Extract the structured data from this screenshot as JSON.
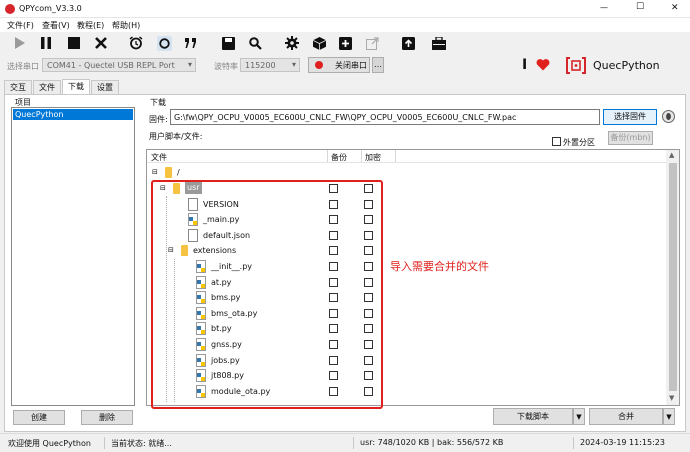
{
  "window": {
    "title": "QPYcom_V3.3.0",
    "minimize_glyph": "—",
    "maximize_glyph": "☐",
    "close_glyph": "✕"
  },
  "menu": [
    {
      "label": "文件(F)"
    },
    {
      "label": "查看(V)"
    },
    {
      "label": "教程(E)"
    },
    {
      "label": "帮助(H)"
    }
  ],
  "toolbar": {
    "icons": [
      "play-icon",
      "pause-icon",
      "stop-icon",
      "close-icon",
      "alarm-icon",
      "recycle-icon",
      "quote-icon",
      "save-icon",
      "search-icon",
      "gear-icon",
      "cube-icon",
      "add-icon",
      "external-link-icon",
      "upload-icon",
      "toolbox-icon"
    ]
  },
  "port": {
    "select_label": "选择串口",
    "port_value": "COM41 - Quectel USB REPL Port",
    "baud_label": "波特率",
    "baud_value": "115200",
    "close_port_label": "关闭串口",
    "more_label": "…"
  },
  "brand": {
    "name": "QuecPython",
    "accent": "#d7262b"
  },
  "tabs": [
    {
      "label": "交互"
    },
    {
      "label": "文件"
    },
    {
      "label": "下载"
    },
    {
      "label": "设置"
    }
  ],
  "project": {
    "header": "项目",
    "items": [
      "QuecPython"
    ],
    "create_label": "创建",
    "delete_label": "删除"
  },
  "download": {
    "section_label": "下载",
    "firmware_label": "固件:",
    "firmware_path": "G:\\fw\\QPY_OCPU_V0005_EC600U_CNLC_FW\\QPY_OCPU_V0005_EC600U_CNLC_FW.pac",
    "choose_firmware_label": "选择固件",
    "user_script_label": "用户脚本/文件:",
    "external_partition_label": "外置分区",
    "backup_label": "备份(mbn)",
    "columns": {
      "file": "文件",
      "backup": "备份",
      "encrypt": "加密"
    },
    "root_label": "/",
    "tree": [
      {
        "name": "usr",
        "type": "folder",
        "depth": 1
      },
      {
        "name": "VERSION",
        "type": "file",
        "depth": 2
      },
      {
        "name": "_main.py",
        "type": "py",
        "depth": 2
      },
      {
        "name": "default.json",
        "type": "file",
        "depth": 2
      },
      {
        "name": "extensions",
        "type": "folder",
        "depth": 2
      },
      {
        "name": "__init__.py",
        "type": "py",
        "depth": 3
      },
      {
        "name": "at.py",
        "type": "py",
        "depth": 3
      },
      {
        "name": "bms.py",
        "type": "py",
        "depth": 3
      },
      {
        "name": "bms_ota.py",
        "type": "py",
        "depth": 3
      },
      {
        "name": "bt.py",
        "type": "py",
        "depth": 3
      },
      {
        "name": "gnss.py",
        "type": "py",
        "depth": 3
      },
      {
        "name": "jobs.py",
        "type": "py",
        "depth": 3
      },
      {
        "name": "jt808.py",
        "type": "py",
        "depth": 3
      },
      {
        "name": "module_ota.py",
        "type": "py",
        "depth": 3
      }
    ],
    "annotation": "导入需要合并的文件",
    "download_script_label": "下载脚本",
    "merge_label": "合并"
  },
  "status": {
    "welcome": "欢迎使用 QuecPython",
    "current_state": "当前状态: 就绪...",
    "usage": "usr: 748/1020 KB | bak: 556/572 KB",
    "timestamp": "2024-03-19 11:15:23"
  },
  "colors": {
    "highlight": "#0078d7",
    "annotation": "#e0201c",
    "folder": "#f5c242"
  }
}
